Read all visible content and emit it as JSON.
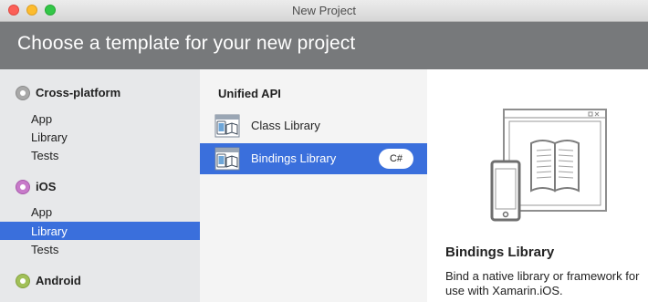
{
  "window": {
    "title": "New Project"
  },
  "header": {
    "title": "Choose a template for your new project"
  },
  "sidebar": {
    "categories": [
      {
        "label": "Cross-platform",
        "icon": "cross-platform-icon",
        "items": [
          "App",
          "Library",
          "Tests"
        ]
      },
      {
        "label": "iOS",
        "icon": "ios-icon",
        "items": [
          "App",
          "Library",
          "Tests"
        ],
        "selected_item": "Library"
      },
      {
        "label": "Android",
        "icon": "android-icon",
        "items": []
      }
    ]
  },
  "templates": {
    "section_title": "Unified API",
    "items": [
      {
        "label": "Class Library",
        "icon": "class-library-icon"
      },
      {
        "label": "Bindings Library",
        "icon": "bindings-library-icon",
        "selected": true,
        "language": "C#"
      }
    ]
  },
  "preview": {
    "title": "Bindings Library",
    "description": "Bind a native library or framework for use with Xamarin.iOS."
  },
  "colors": {
    "selection": "#3a6fdc",
    "header": "#77797b",
    "sidebar_bg": "#e7e8ea",
    "list_bg": "#f4f4f4"
  }
}
